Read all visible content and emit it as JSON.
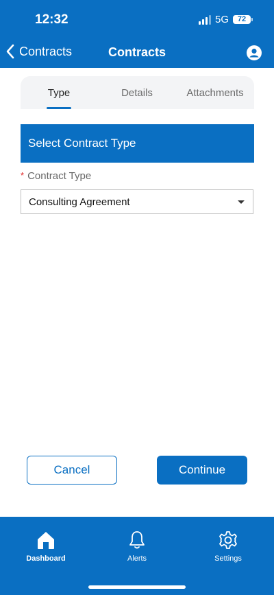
{
  "status_bar": {
    "time": "12:32",
    "network": "5G",
    "battery": "72"
  },
  "nav_bar": {
    "back_label": "Contracts",
    "title": "Contracts"
  },
  "tabs": [
    {
      "label": "Type",
      "active": true
    },
    {
      "label": "Details",
      "active": false
    },
    {
      "label": "Attachments",
      "active": false
    }
  ],
  "form": {
    "section_title": "Select Contract Type",
    "required_marker": "*",
    "contract_type_label": "Contract Type",
    "contract_type_value": "Consulting Agreement"
  },
  "actions": {
    "cancel_label": "Cancel",
    "continue_label": "Continue"
  },
  "bottom_nav": [
    {
      "label": "Dashboard",
      "icon": "home-icon",
      "active": true
    },
    {
      "label": "Alerts",
      "icon": "bell-icon",
      "active": false
    },
    {
      "label": "Settings",
      "icon": "gear-icon",
      "active": false
    }
  ],
  "colors": {
    "primary": "#0a6fc2",
    "required": "#e02424"
  }
}
